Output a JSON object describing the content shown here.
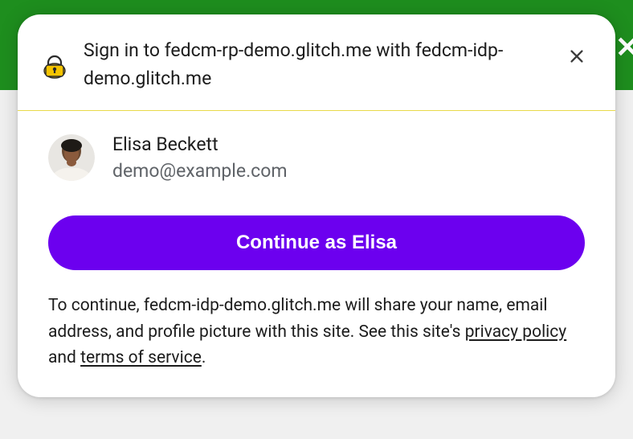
{
  "header": {
    "title_prefix": "Sign in to ",
    "rp_domain": "fedcm-rp-demo.glitch.me",
    "title_mid": " with ",
    "idp_domain": "fedcm-idp-demo.glitch.me",
    "lock_icon": "lock-icon",
    "close_icon": "close-icon"
  },
  "account": {
    "name": "Elisa Beckett",
    "email": "demo@example.com"
  },
  "continue_button": {
    "label": "Continue as Elisa"
  },
  "disclosure": {
    "prefix": "To continue, ",
    "idp_domain": "fedcm-idp-demo.glitch.me",
    "mid": " will share your name, email address, and profile picture with this site. See this site's ",
    "privacy_link": "privacy policy",
    "and": " and ",
    "terms_link": "terms of service",
    "suffix": "."
  },
  "colors": {
    "green": "#1e8e1e",
    "accent": "#6c00ef"
  }
}
